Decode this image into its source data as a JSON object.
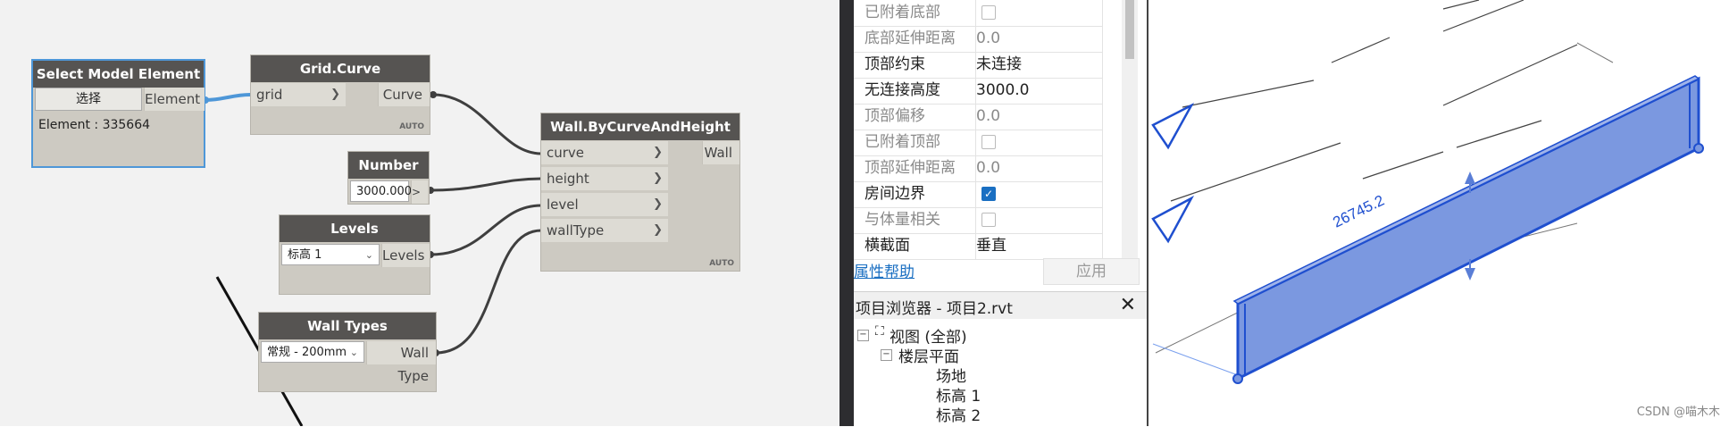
{
  "dynamo": {
    "select_node": {
      "title": "Select Model Element",
      "button_label": "选择",
      "output": "Element",
      "info": "Element : 335664"
    },
    "grid_node": {
      "title": "Grid.Curve",
      "input": "grid",
      "output": "Curve",
      "lacing": "AUTO"
    },
    "number_node": {
      "title": "Number",
      "value": "3000.000",
      "output": ">"
    },
    "levels_node": {
      "title": "Levels",
      "selected": "标高 1",
      "output": "Levels"
    },
    "walltypes_node": {
      "title": "Wall Types",
      "selected": "常规 - 200mm",
      "output": "Wall Type"
    },
    "wall_node": {
      "title": "Wall.ByCurveAndHeight",
      "inputs": [
        "curve",
        "height",
        "level",
        "wallType"
      ],
      "output": "Wall",
      "lacing": "AUTO"
    }
  },
  "properties": {
    "rows": [
      {
        "label": "已附着底部",
        "value": "",
        "type": "checkbox",
        "checked": false,
        "enabled": false
      },
      {
        "label": "底部延伸距离",
        "value": "0.0",
        "type": "text",
        "enabled": false
      },
      {
        "label": "顶部约束",
        "value": "未连接",
        "type": "text",
        "enabled": true
      },
      {
        "label": "无连接高度",
        "value": "3000.0",
        "type": "text",
        "enabled": true
      },
      {
        "label": "顶部偏移",
        "value": "0.0",
        "type": "text",
        "enabled": false
      },
      {
        "label": "已附着顶部",
        "value": "",
        "type": "checkbox",
        "checked": false,
        "enabled": false
      },
      {
        "label": "顶部延伸距离",
        "value": "0.0",
        "type": "text",
        "enabled": false
      },
      {
        "label": "房间边界",
        "value": "",
        "type": "checkbox",
        "checked": true,
        "enabled": true
      },
      {
        "label": "与体量相关",
        "value": "",
        "type": "checkbox",
        "checked": false,
        "enabled": false
      },
      {
        "label": "横截面",
        "value": "垂直",
        "type": "text",
        "enabled": true
      }
    ],
    "help_link": "属性帮助",
    "apply_button": "应用"
  },
  "project_browser": {
    "title": "项目浏览器 - 项目2.rvt",
    "close": "✕",
    "tree": [
      {
        "label": "视图 (全部)",
        "level": 0,
        "toggle": "−"
      },
      {
        "label": "楼层平面",
        "level": 1,
        "toggle": "−"
      },
      {
        "label": "场地",
        "level": 2
      },
      {
        "label": "标高 1",
        "level": 2
      },
      {
        "label": "标高 2",
        "level": 2
      }
    ]
  },
  "view3d": {
    "dimension": "26745.2",
    "wall_color": "#7b98e0",
    "wall_edge_color": "#1f4fcf",
    "watermark": "CSDN @喵木木"
  },
  "colors": {
    "node_header": "#565452",
    "node_body": "#cdcac2",
    "selection": "#4e97d8",
    "wire": "#3f3f3f",
    "link": "#1a6fc2"
  }
}
